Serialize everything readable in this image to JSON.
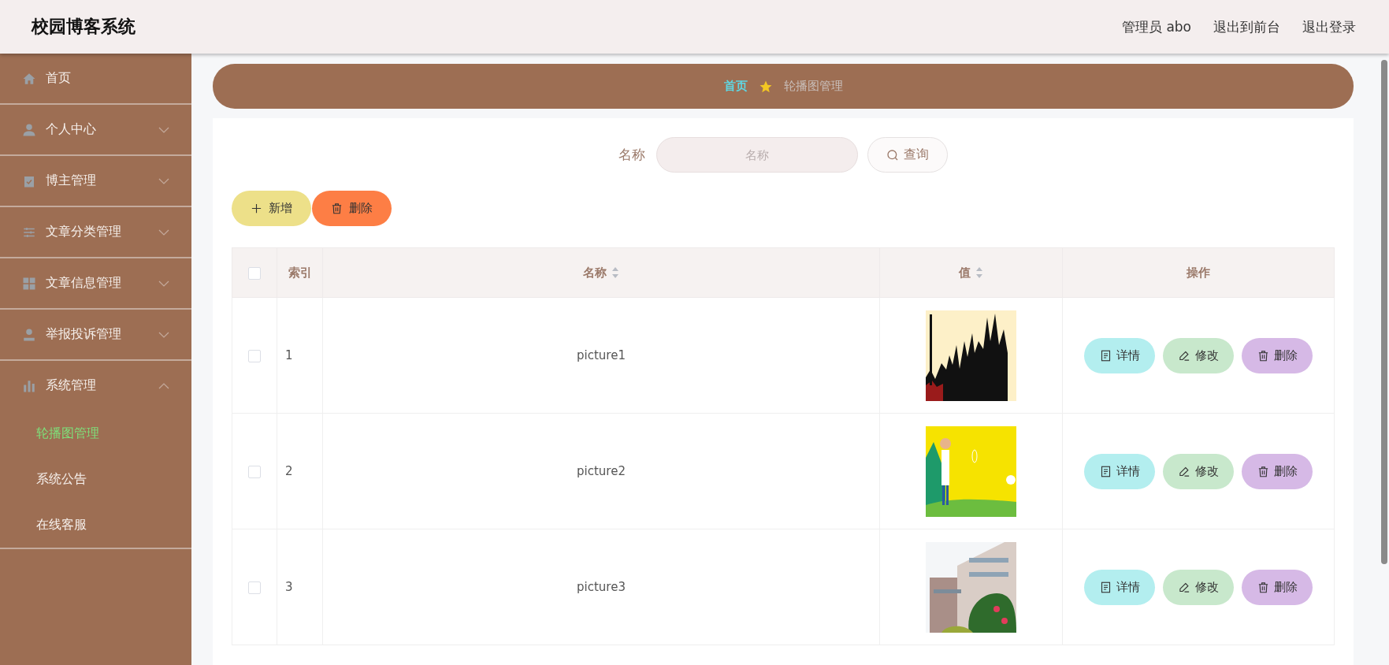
{
  "header": {
    "title": "校园博客系统",
    "links": [
      "管理员 abo",
      "退出到前台",
      "退出登录"
    ]
  },
  "sidebar": {
    "items": [
      {
        "label": "首页",
        "kind": "link"
      },
      {
        "label": "个人中心",
        "kind": "group",
        "expanded": false
      },
      {
        "label": "博主管理",
        "kind": "group",
        "expanded": false
      },
      {
        "label": "文章分类管理",
        "kind": "group",
        "expanded": false
      },
      {
        "label": "文章信息管理",
        "kind": "group",
        "expanded": false
      },
      {
        "label": "举报投诉管理",
        "kind": "group",
        "expanded": false
      },
      {
        "label": "系统管理",
        "kind": "group",
        "expanded": true,
        "children": [
          {
            "label": "轮播图管理",
            "selected": true
          },
          {
            "label": "系统公告",
            "selected": false
          },
          {
            "label": "在线客服",
            "selected": false
          }
        ]
      }
    ]
  },
  "breadcrumb": {
    "home": "首页",
    "current": "轮播图管理"
  },
  "search": {
    "label": "名称",
    "placeholder": "名称",
    "button": "查询"
  },
  "actions": [
    {
      "label": "新增",
      "kind": "add"
    },
    {
      "label": "删除",
      "kind": "delete"
    }
  ],
  "table": {
    "columns": [
      {
        "kind": "checkbox",
        "checked": false
      },
      {
        "kind": "text",
        "label": "索引",
        "sortable": false
      },
      {
        "kind": "text",
        "label": "名称",
        "sortable": true
      },
      {
        "kind": "text",
        "label": "值",
        "sortable": true
      },
      {
        "kind": "text",
        "label": "操作",
        "sortable": false
      }
    ],
    "rows": [
      {
        "checked": false,
        "index": "1",
        "name": "picture1",
        "actions": [
          {
            "label": "详情",
            "kind": "detail"
          },
          {
            "label": "修改",
            "kind": "edit"
          },
          {
            "label": "删除",
            "kind": "delete"
          }
        ]
      },
      {
        "checked": false,
        "index": "2",
        "name": "picture2",
        "actions": [
          {
            "label": "详情",
            "kind": "detail"
          },
          {
            "label": "修改",
            "kind": "edit"
          },
          {
            "label": "删除",
            "kind": "delete"
          }
        ]
      },
      {
        "checked": false,
        "index": "3",
        "name": "picture3",
        "actions": [
          {
            "label": "详情",
            "kind": "detail"
          },
          {
            "label": "修改",
            "kind": "edit"
          },
          {
            "label": "删除",
            "kind": "delete"
          }
        ]
      }
    ]
  }
}
